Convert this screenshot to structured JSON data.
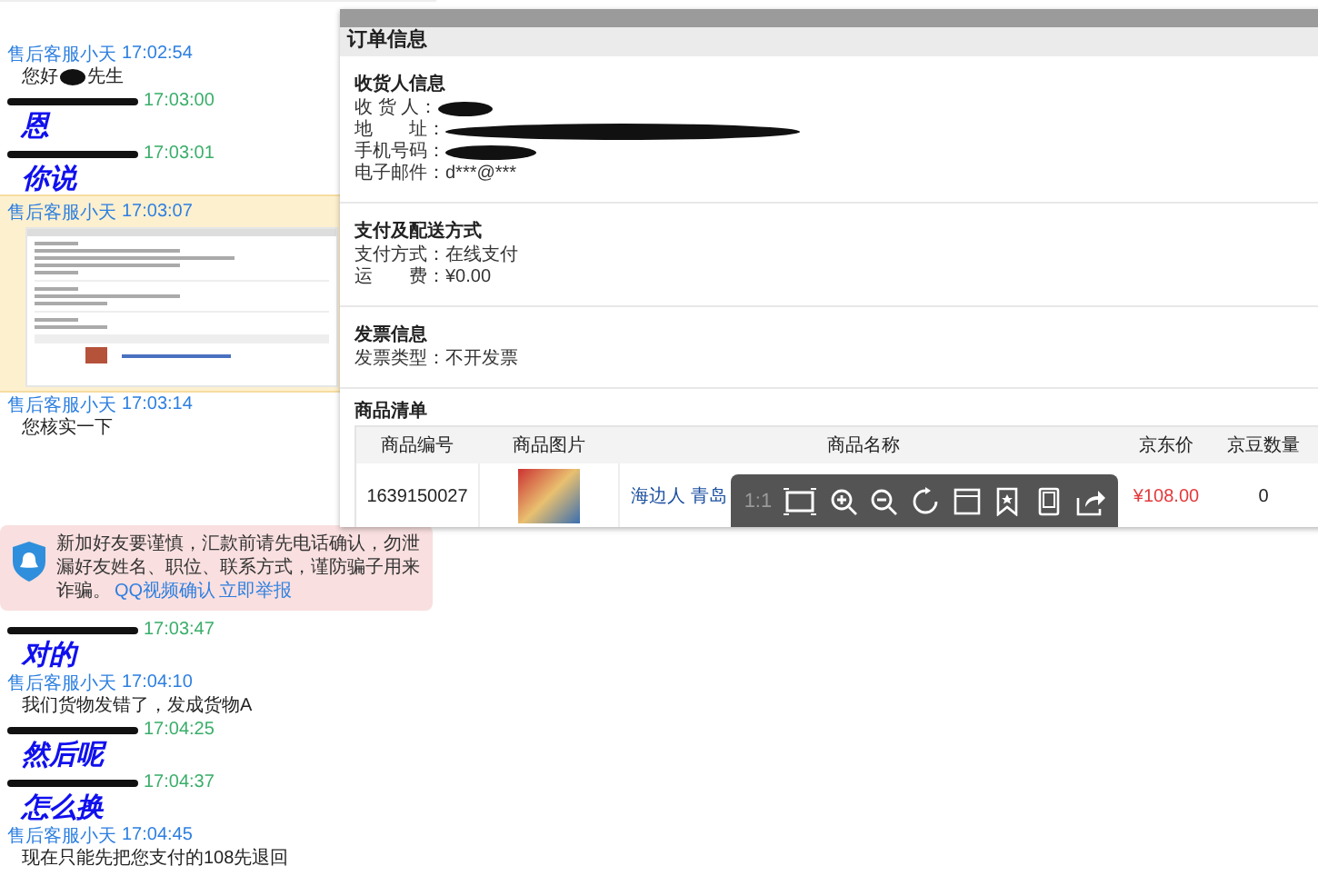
{
  "chat": {
    "messages": [
      {
        "kind": "agent",
        "sender": "售后客服小天",
        "time": "17:02:54",
        "highlighted": false,
        "body": {
          "kind": "redacted_text",
          "before": "您好",
          "after": "先生"
        }
      },
      {
        "kind": "customer",
        "time": "17:03:00",
        "highlighted": false,
        "body": {
          "kind": "handwriting",
          "text": "恩"
        }
      },
      {
        "kind": "customer",
        "time": "17:03:01",
        "highlighted": false,
        "body": {
          "kind": "handwriting",
          "text": "你说"
        }
      },
      {
        "kind": "agent",
        "sender": "售后客服小天",
        "time": "17:03:07",
        "highlighted": true,
        "body": {
          "kind": "screenshot"
        }
      },
      {
        "kind": "agent",
        "sender": "售后客服小天",
        "time": "17:03:14",
        "highlighted": false,
        "body": {
          "kind": "text",
          "text": "您核实一下"
        }
      },
      {
        "kind": "system",
        "highlighted": false,
        "body": {
          "kind": "warning",
          "text": "新加好友要谨慎，汇款前请先电话确认，勿泄漏好友姓名、职位、联系方式，谨防骗子用来诈骗。",
          "links": [
            "QQ视频确认",
            "立即举报"
          ]
        }
      },
      {
        "kind": "customer",
        "time": "17:03:47",
        "highlighted": false,
        "body": {
          "kind": "handwriting",
          "text": "对的"
        }
      },
      {
        "kind": "agent",
        "sender": "售后客服小天",
        "time": "17:04:10",
        "highlighted": false,
        "body": {
          "kind": "text",
          "text": "我们货物发错了，发成货物A"
        }
      },
      {
        "kind": "customer",
        "time": "17:04:25",
        "highlighted": false,
        "body": {
          "kind": "handwriting",
          "text": "然后呢"
        }
      },
      {
        "kind": "customer",
        "time": "17:04:37",
        "highlighted": false,
        "body": {
          "kind": "handwriting",
          "text": "怎么换"
        }
      },
      {
        "kind": "agent",
        "sender": "售后客服小天",
        "time": "17:04:45",
        "highlighted": false,
        "body": {
          "kind": "text",
          "text": "现在只能先把您支付的108先退回"
        }
      }
    ]
  },
  "order_viewer": {
    "title": "订单信息",
    "sections": [
      {
        "heading": "收货人信息",
        "fields": [
          {
            "label": "收 货 人：",
            "redacted": true
          },
          {
            "label": "地　　址：",
            "redacted": true
          },
          {
            "label": "手机号码：",
            "redacted": true
          },
          {
            "label": "电子邮件：",
            "redacted": false,
            "value": "d***@***"
          }
        ]
      },
      {
        "heading": "支付及配送方式",
        "fields": [
          {
            "label": "支付方式：",
            "redacted": false,
            "value": "在线支付"
          },
          {
            "label": "运　　费：",
            "redacted": false,
            "value": "¥0.00"
          }
        ]
      },
      {
        "heading": "发票信息",
        "fields": [
          {
            "label": "发票类型：",
            "redacted": false,
            "value": "不开发票"
          }
        ]
      }
    ],
    "product_list": {
      "heading": "商品清单",
      "columns": [
        "商品编号",
        "商品图片",
        "商品名称",
        "京东价",
        "京豆数量"
      ],
      "rows": [
        {
          "id": "1639150027",
          "name": "海边人 青岛",
          "price": "¥108.00",
          "beans": "0"
        }
      ]
    },
    "toolbar": {
      "zoom_label": "1:1"
    }
  }
}
